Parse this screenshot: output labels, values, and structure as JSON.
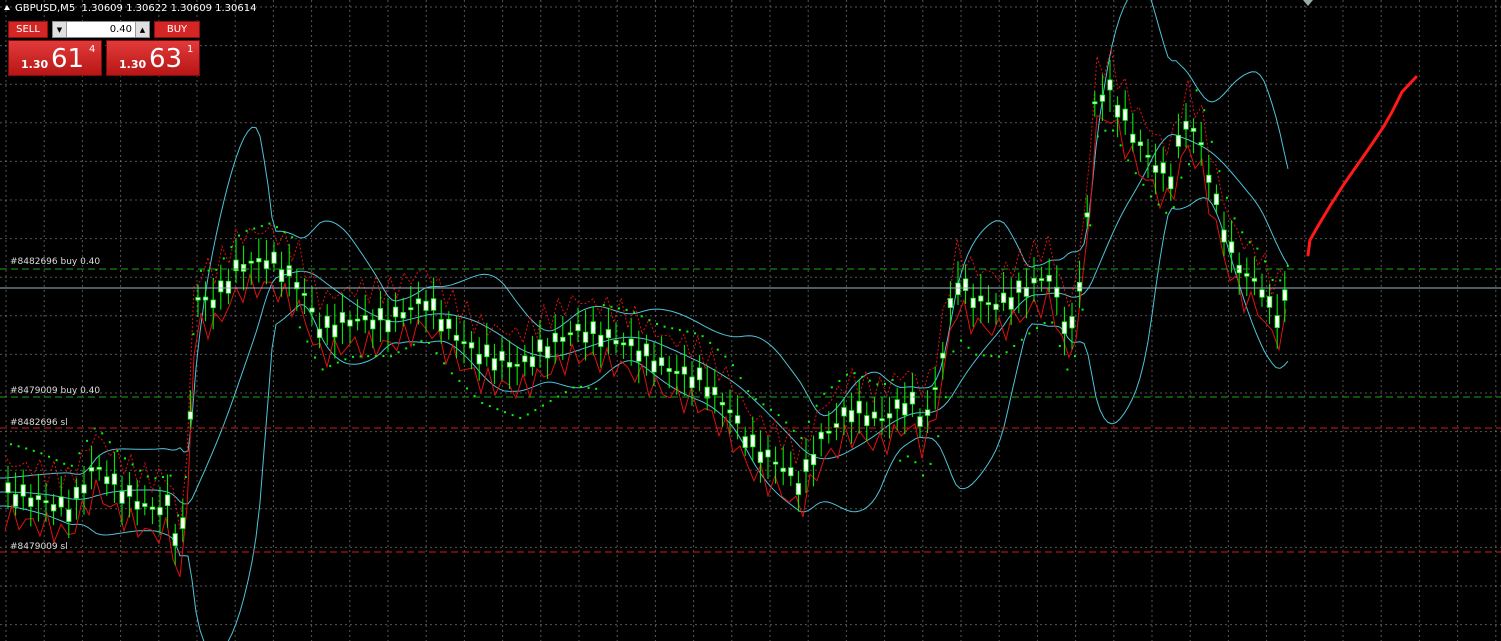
{
  "header": {
    "symbol": "GBPUSD,M5",
    "ohlc": "1.30609 1.30622 1.30609 1.30614"
  },
  "trade_panel": {
    "sell_label": "SELL",
    "buy_label": "BUY",
    "volume": "0.40",
    "bid": {
      "prefix": "1.30",
      "big": "61",
      "sup": "4"
    },
    "ask": {
      "prefix": "1.30",
      "big": "63",
      "sup": "1"
    }
  },
  "orders": [
    {
      "label": "#8482696 buy 0.40",
      "kind": "entry"
    },
    {
      "label": "#8479009 buy 0.40",
      "kind": "entry"
    },
    {
      "label": "#8482696 sl",
      "kind": "stop"
    },
    {
      "label": "#8479009 sl",
      "kind": "stop"
    }
  ],
  "colors": {
    "background": "#000000",
    "grid": "#9a9a9a",
    "candle_up": "#00ff00",
    "candle_body": "#ffffff",
    "bollinger": "#4fc3d8",
    "envelope": "#e01010",
    "parabolic_sar": "#00ff00",
    "entry_line": "#17a817",
    "stop_line": "#d01818",
    "current_price_line": "#9fb7c8",
    "annotation": "#ff1a1a",
    "button_red": "#d52626"
  },
  "icons": {
    "collapse": "triangle-up-icon",
    "spin_down": "spin-down-icon",
    "spin_up": "spin-up-icon",
    "shift_marker": "chart-shift-icon"
  }
}
